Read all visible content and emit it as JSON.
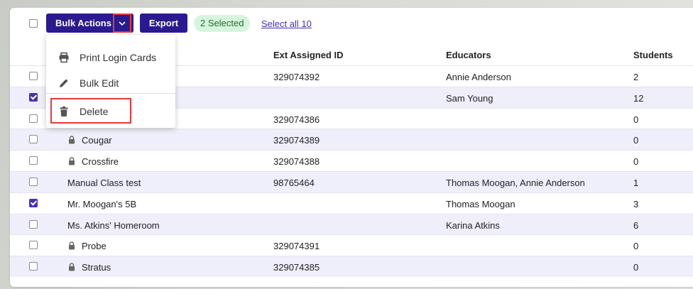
{
  "toolbar": {
    "bulk_actions_label": "Bulk Actions",
    "export_label": "Export",
    "selected_badge": "2 Selected",
    "select_all_label": "Select all 10"
  },
  "bulk_menu": {
    "items": [
      {
        "label": "Print Login Cards",
        "icon": "printer-icon"
      },
      {
        "label": "Bulk Edit",
        "icon": "pencil-icon"
      },
      {
        "label": "Delete",
        "icon": "trash-icon"
      }
    ]
  },
  "table": {
    "headers": [
      "Ext Assigned ID",
      "Educators",
      "Students"
    ],
    "rows": [
      {
        "name": "",
        "locked": false,
        "checked": false,
        "ext_id": "329074392",
        "educators": "Annie Anderson",
        "students": "2"
      },
      {
        "name": "",
        "locked": false,
        "checked": true,
        "ext_id": "",
        "educators": "Sam Young",
        "students": "12"
      },
      {
        "name": "",
        "locked": false,
        "checked": false,
        "ext_id": "329074386",
        "educators": "",
        "students": "0"
      },
      {
        "name": "Cougar",
        "locked": true,
        "checked": false,
        "ext_id": "329074389",
        "educators": "",
        "students": "0"
      },
      {
        "name": "Crossfire",
        "locked": true,
        "checked": false,
        "ext_id": "329074388",
        "educators": "",
        "students": "0"
      },
      {
        "name": "Manual Class test",
        "locked": false,
        "checked": false,
        "ext_id": "98765464",
        "educators": "Thomas Moogan, Annie Anderson",
        "students": "1"
      },
      {
        "name": "Mr. Moogan's 5B",
        "locked": false,
        "checked": true,
        "ext_id": "",
        "educators": "Thomas Moogan",
        "students": "3"
      },
      {
        "name": "Ms. Atkins' Homeroom",
        "locked": false,
        "checked": false,
        "ext_id": "",
        "educators": "Karina Atkins",
        "students": "6"
      },
      {
        "name": "Probe",
        "locked": true,
        "checked": false,
        "ext_id": "329074391",
        "educators": "",
        "students": "0"
      },
      {
        "name": "Stratus",
        "locked": true,
        "checked": false,
        "ext_id": "329074385",
        "educators": "",
        "students": "0"
      }
    ]
  },
  "colors": {
    "primary": "#2a1a8f",
    "accent": "#4a2fb4",
    "row_alt": "#efeefb",
    "highlight": "#e53a3a",
    "badge_bg": "#d7f5dc"
  }
}
